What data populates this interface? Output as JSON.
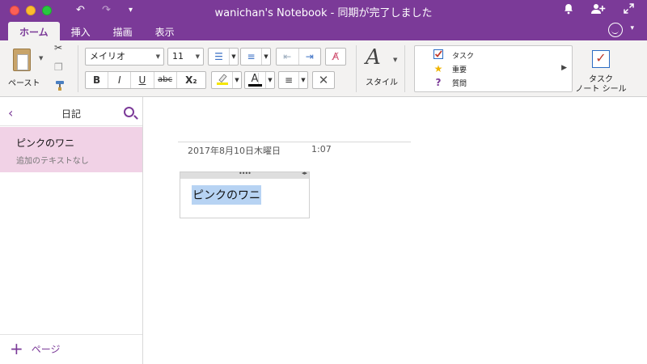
{
  "window": {
    "title": "wanichan's Notebook - 同期が完了しました",
    "buttons": [
      "close",
      "minimize",
      "maximize"
    ]
  },
  "titlebar_tools": {
    "undo_icon": "undo-icon",
    "redo_icon": "redo-icon",
    "customize_icon": "chevron-down-icon",
    "bell_icon": "bell-icon",
    "add_person_icon": "add-person-icon",
    "fullscreen_icon": "expand-icon"
  },
  "tabs": [
    {
      "label": "ホーム",
      "active": true
    },
    {
      "label": "挿入",
      "active": false
    },
    {
      "label": "描画",
      "active": false
    },
    {
      "label": "表示",
      "active": false
    }
  ],
  "ribbon": {
    "paste_label": "ペースト",
    "font_name": "メイリオ",
    "font_size": "11",
    "bold": "B",
    "italic": "I",
    "underline": "U",
    "strike": "abc",
    "subscript": "X₂",
    "font_color_glyph": "A",
    "style_label": "スタイル",
    "tags": [
      {
        "icon": "checkbox-icon",
        "label": "タスク"
      },
      {
        "icon": "star-icon",
        "label": "重要"
      },
      {
        "icon": "question-icon",
        "label": "質問"
      }
    ],
    "tag_task_label_line1": "タスク",
    "tag_task_label_line2": "ノート シール"
  },
  "sidebar": {
    "section_title": "日記",
    "pages": [
      {
        "title": "ピンクのワニ",
        "subtitle": "追加のテキストなし"
      }
    ],
    "add_page_label": "ページ"
  },
  "note": {
    "date": "2017年8月10日木曜日",
    "time": "1:07",
    "content": "ピンクのワニ"
  },
  "colors": {
    "accent": "#7b3a98",
    "selected_page": "#f1d2e6",
    "highlight_yellow": "#f5e600",
    "selection": "#b7d3f3"
  }
}
